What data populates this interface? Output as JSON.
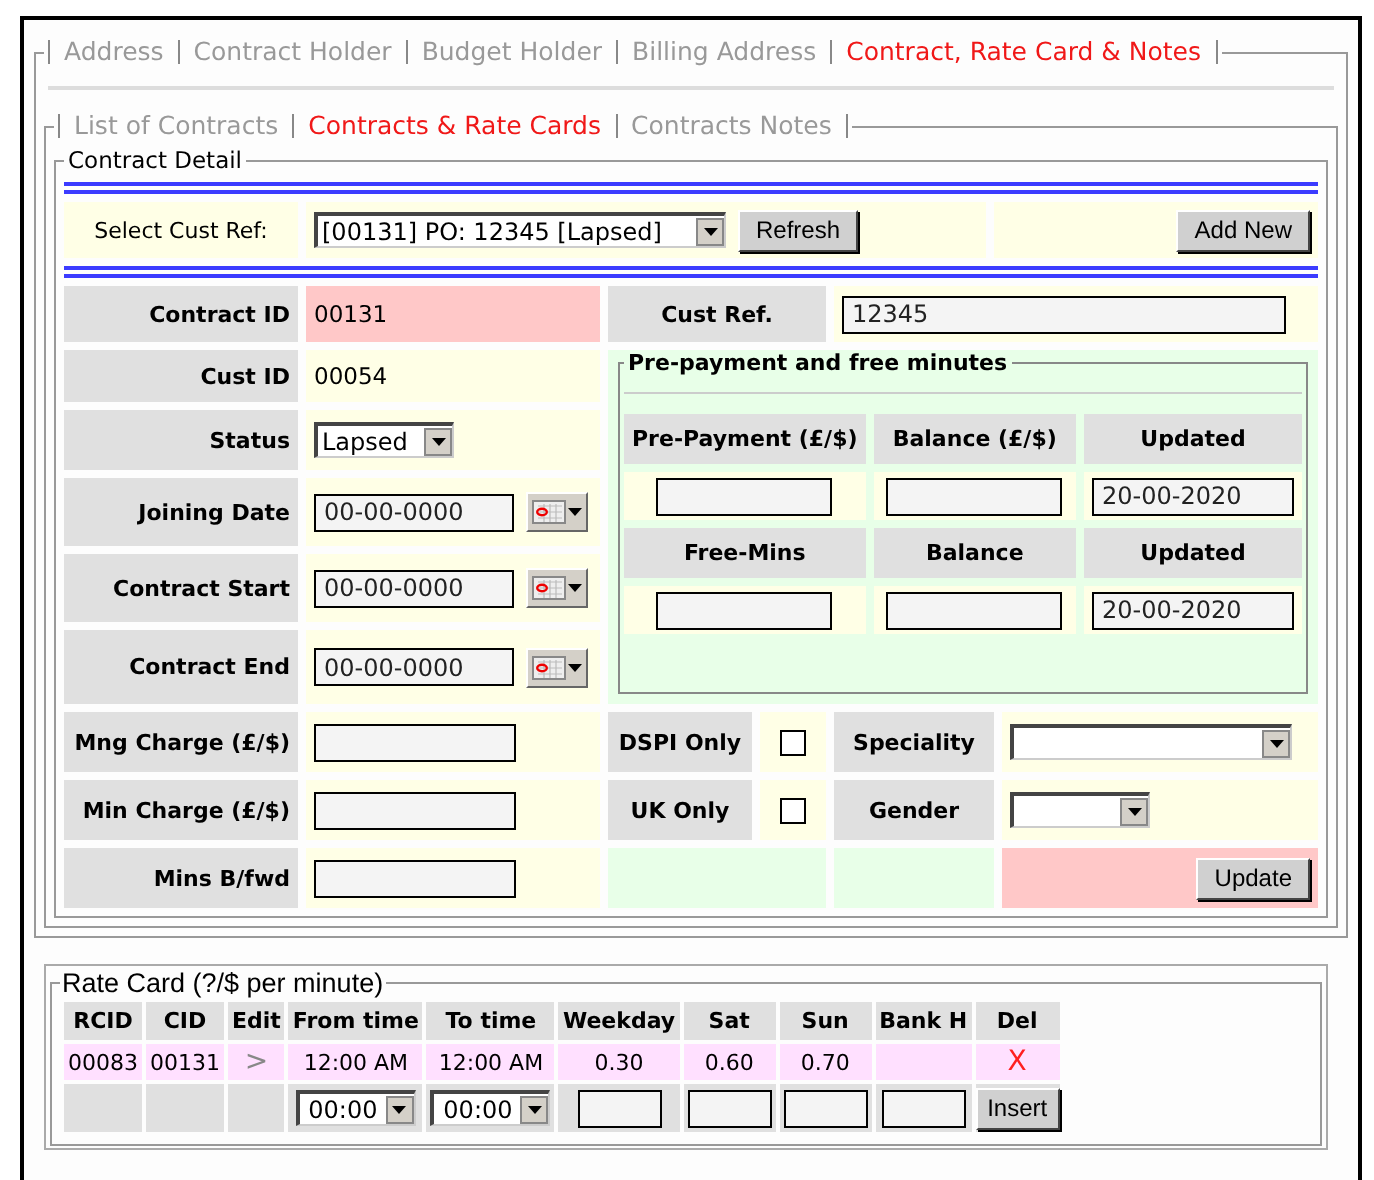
{
  "tabs": [
    {
      "label": "Address",
      "selected": false
    },
    {
      "label": "Contract Holder",
      "selected": false
    },
    {
      "label": "Budget Holder",
      "selected": false
    },
    {
      "label": "Billing Address",
      "selected": false
    },
    {
      "label": "Contract, Rate Card & Notes",
      "selected": true
    }
  ],
  "subtabs": [
    {
      "label": "List of Contracts",
      "selected": false
    },
    {
      "label": "Contracts & Rate Cards",
      "selected": true
    },
    {
      "label": "Contracts Notes",
      "selected": false
    }
  ],
  "contract_detail": {
    "title": "Contract Detail",
    "select_cust_ref": {
      "label": "Select Cust Ref:",
      "value": "[00131] PO: 12345 [Lapsed]"
    },
    "refresh_button": "Refresh",
    "add_new_button": "Add New",
    "fields": [
      {
        "label": "Contract ID",
        "kind": "text",
        "value": "00131",
        "highlighted": true
      },
      {
        "label": "Cust ID",
        "kind": "text",
        "value": "00054",
        "highlighted": false
      },
      {
        "label": "Status",
        "kind": "select",
        "value": "Lapsed"
      },
      {
        "label": "Joining Date",
        "kind": "date",
        "value": "00-00-0000"
      },
      {
        "label": "Contract Start",
        "kind": "date",
        "value": "00-00-0000"
      },
      {
        "label": "Contract End",
        "kind": "date",
        "value": "00-00-0000"
      },
      {
        "label": "Mng Charge (£/$)",
        "kind": "input"
      },
      {
        "label": "Min Charge (£/$)",
        "kind": "input"
      },
      {
        "label": "Mins B/fwd",
        "kind": "input"
      }
    ],
    "cust_ref": {
      "label": "Cust Ref.",
      "value": "12345"
    },
    "prepayment": {
      "title": "Pre-payment and free minutes",
      "rows": [
        {
          "headers": [
            "Pre-Payment (£/$)",
            "Balance (£/$)",
            "Updated"
          ],
          "inputs": [
            {
              "kind": "input"
            },
            {
              "kind": "input"
            },
            {
              "kind": "input",
              "value": "20-00-2020"
            }
          ]
        },
        {
          "headers": [
            "Free-Mins",
            "Balance",
            "Updated"
          ],
          "inputs": [
            {
              "kind": "input"
            },
            {
              "kind": "input"
            },
            {
              "kind": "input",
              "value": "20-00-2020"
            }
          ]
        }
      ]
    },
    "dspi_only": {
      "label": "DSPI Only",
      "checked": false
    },
    "uk_only": {
      "label": "UK Only",
      "checked": false
    },
    "speciality": {
      "label": "Speciality"
    },
    "gender": {
      "label": "Gender"
    },
    "update_button": "Update"
  },
  "rate_card": {
    "title": "Rate Card (?/$ per minute)",
    "columns": [
      "RCID",
      "CID",
      "Edit",
      "From time",
      "To time",
      "Weekday",
      "Sat",
      "Sun",
      "Bank H",
      "Del"
    ],
    "rows": [
      {
        "rcid": "00083",
        "cid": "00131",
        "edit": ">",
        "from": "12:00 AM",
        "to": "12:00 AM",
        "weekday": "0.30",
        "sat": "0.60",
        "sun": "0.70",
        "del": "X"
      }
    ],
    "new_row": {
      "from": "00:00",
      "to": "00:00",
      "insert_button": "Insert"
    }
  }
}
